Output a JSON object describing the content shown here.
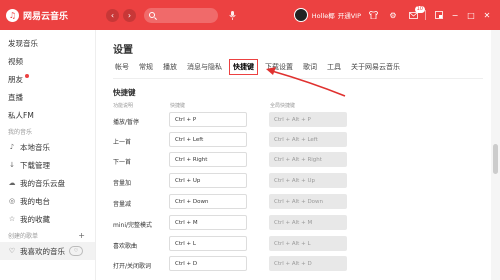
{
  "titlebar": {
    "app_name": "网易云音乐",
    "username": "Holle椰",
    "vip_label": "开通VIP",
    "mail_badge": "10"
  },
  "sidebar": {
    "items_top": [
      {
        "label": "发现音乐"
      },
      {
        "label": "视频"
      },
      {
        "label": "朋友"
      },
      {
        "label": "直播"
      },
      {
        "label": "私人FM"
      }
    ],
    "my_music_title": "我的音乐",
    "my_items": [
      {
        "label": "本地音乐",
        "icon": "local-music-icon"
      },
      {
        "label": "下载管理",
        "icon": "download-icon"
      },
      {
        "label": "我的音乐云盘",
        "icon": "cloud-icon"
      },
      {
        "label": "我的电台",
        "icon": "radio-icon"
      },
      {
        "label": "我的收藏",
        "icon": "collect-icon"
      }
    ],
    "created_title": "创建的歌单",
    "liked_playlist": "我喜欢的音乐"
  },
  "main": {
    "title": "设置",
    "tabs": [
      "帐号",
      "常规",
      "播放",
      "消息与隐私",
      "快捷键",
      "下载设置",
      "歌词",
      "工具",
      "关于网易云音乐"
    ],
    "active_tab_index": 4,
    "section_title": "快捷键",
    "col_function": "功能说明",
    "col_shortcut": "快捷键",
    "col_global": "全局快捷键",
    "rows": [
      {
        "label": "播放/暂停",
        "key": "Ctrl + P",
        "global": "Ctrl + Alt + P"
      },
      {
        "label": "上一首",
        "key": "Ctrl + Left",
        "global": "Ctrl + Alt + Left"
      },
      {
        "label": "下一首",
        "key": "Ctrl + Right",
        "global": "Ctrl + Alt + Right"
      },
      {
        "label": "音量加",
        "key": "Ctrl + Up",
        "global": "Ctrl + Alt + Up"
      },
      {
        "label": "音量减",
        "key": "Ctrl + Down",
        "global": "Ctrl + Alt + Down"
      },
      {
        "label": "mini/完整模式",
        "key": "Ctrl + M",
        "global": "Ctrl + Alt + M"
      },
      {
        "label": "喜欢歌曲",
        "key": "Ctrl + L",
        "global": "Ctrl + Alt + L"
      },
      {
        "label": "打开/关闭歌词",
        "key": "Ctrl + D",
        "global": "Ctrl + Alt + D"
      }
    ]
  },
  "colors": {
    "accent": "#ec4141",
    "global_box_bg": "#e8e8e8"
  },
  "icons": {
    "logo": "netease-logo-icon",
    "back": "chevron-left-icon",
    "forward": "chevron-right-icon",
    "search": "search-icon",
    "mic": "mic-icon",
    "settings": "gear-icon",
    "mail": "mail-icon",
    "skin": "shirt-icon",
    "mini": "mini-mode-icon",
    "minimize": "minimize-icon",
    "maximize": "maximize-icon",
    "close": "close-icon"
  }
}
